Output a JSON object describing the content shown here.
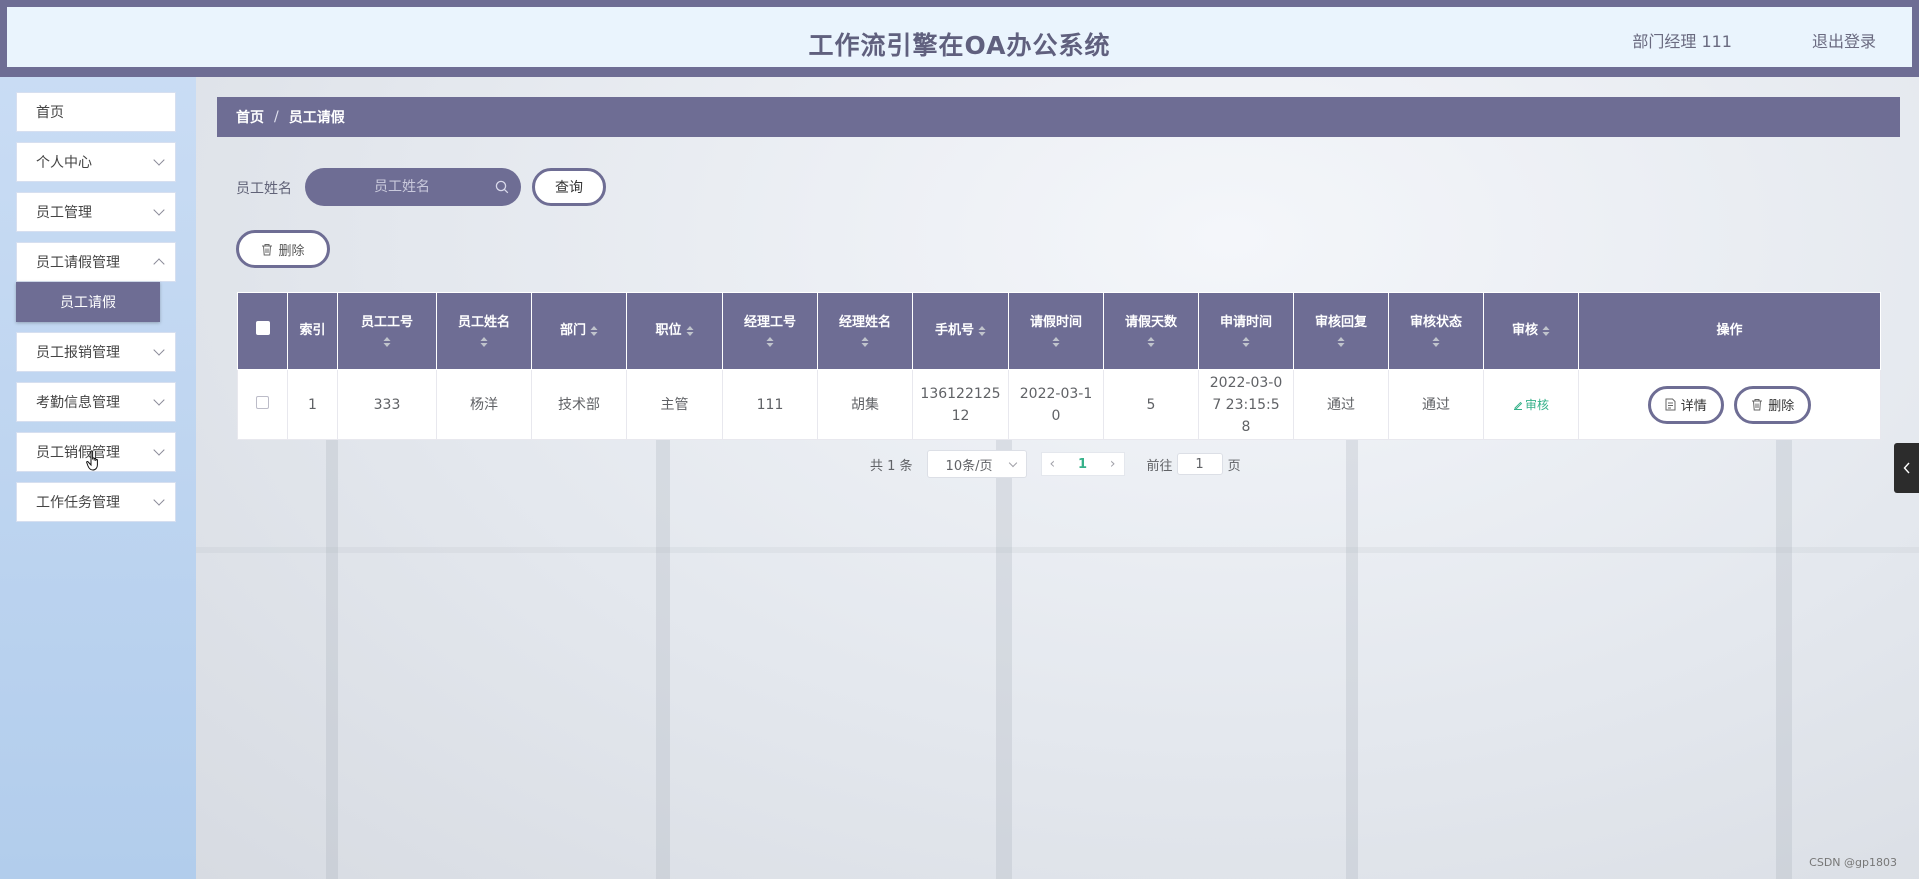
{
  "header": {
    "title": "工作流引擎在OA办公系统",
    "user": "部门经理 111",
    "logout": "退出登录"
  },
  "sidebar": {
    "items": [
      {
        "label": "首页"
      },
      {
        "label": "个人中心"
      },
      {
        "label": "员工管理"
      },
      {
        "label": "员工请假管理"
      },
      {
        "label": "员工报销管理"
      },
      {
        "label": "考勤信息管理"
      },
      {
        "label": "员工销假管理"
      },
      {
        "label": "工作任务管理"
      }
    ],
    "active_sub": "员工请假"
  },
  "breadcrumb": {
    "home": "首页",
    "separator": "/",
    "current": "员工请假"
  },
  "search": {
    "label": "员工姓名",
    "placeholder": "员工姓名",
    "query_button": "查询",
    "delete_button": "删除"
  },
  "table": {
    "columns": [
      "索引",
      "员工工号",
      "员工姓名",
      "部门",
      "职位",
      "经理工号",
      "经理姓名",
      "手机号",
      "请假时间",
      "请假天数",
      "申请时间",
      "审核回复",
      "审核状态",
      "审核",
      "操作"
    ],
    "rows": [
      {
        "index": "1",
        "emp_no": "333",
        "emp_name": "杨洋",
        "dept": "技术部",
        "position": "主管",
        "mgr_no": "111",
        "mgr_name": "胡集",
        "phone": "13612212512",
        "leave_time": "2022-03-10",
        "leave_days": "5",
        "apply_time": "2022-03-07 23:15:58",
        "reply": "通过",
        "status": "通过",
        "audit_link": "审核",
        "detail_btn": "详情",
        "delete_btn": "删除"
      }
    ]
  },
  "pagination": {
    "total": "共 1 条",
    "page_size": "10条/页",
    "current_page": "1",
    "goto_label": "前往",
    "goto_value": "1",
    "page_unit": "页"
  },
  "watermark": "CSDN @gp1803",
  "colors": {
    "primary": "#6e6d94",
    "header_bg": "#eaf4fd",
    "accent_green": "#36b18a"
  }
}
